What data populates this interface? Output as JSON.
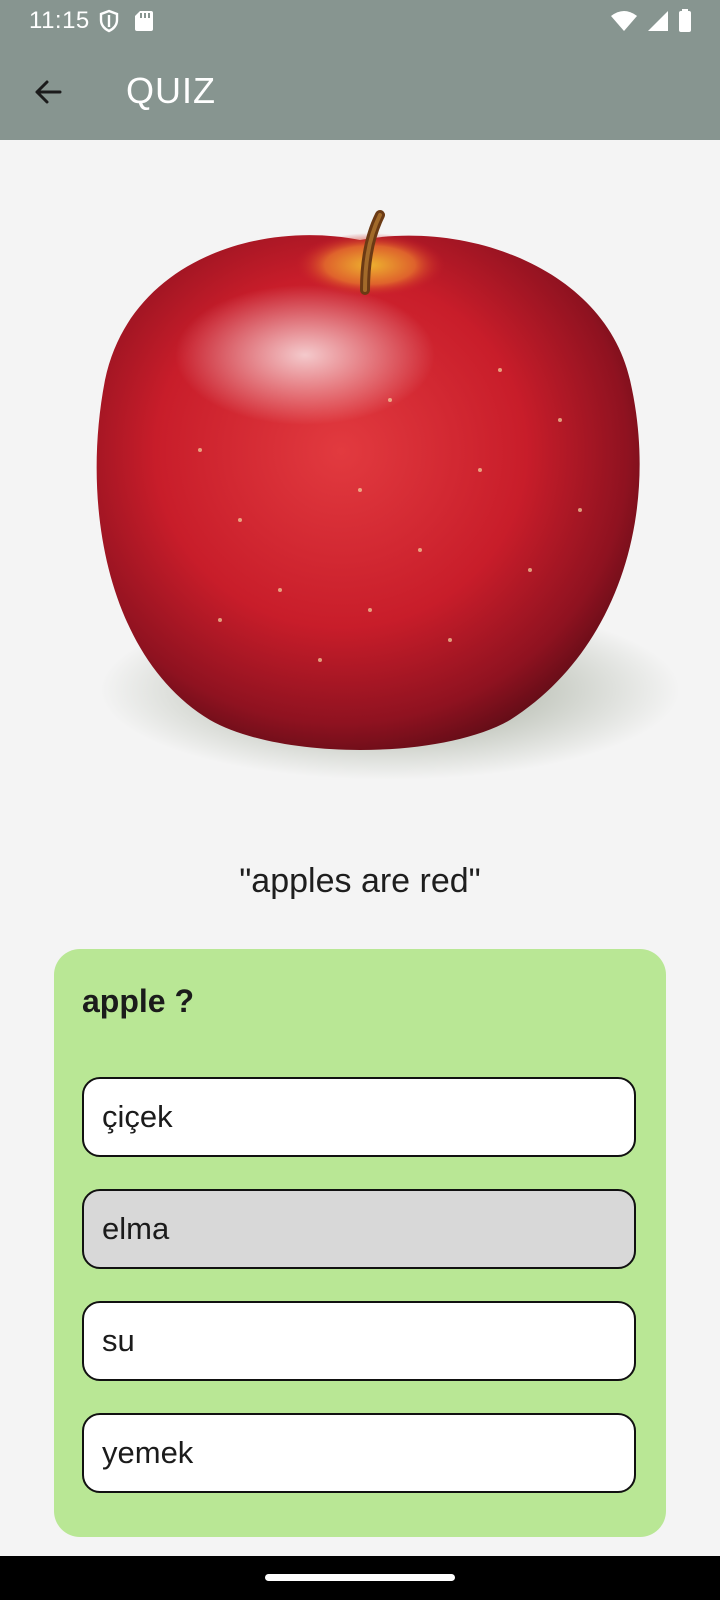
{
  "status_bar": {
    "time": "11:15",
    "icons": [
      "shield-icon",
      "sd-card-icon",
      "wifi-icon",
      "cellular-signal-icon",
      "battery-icon"
    ]
  },
  "app_bar": {
    "back_icon": "arrow-back-icon",
    "title": "QUIZ",
    "background": "#879590"
  },
  "main": {
    "image_subject": "red apple",
    "caption": "\"apples are red\""
  },
  "quiz": {
    "question": "apple ?",
    "card_color": "#b9e795",
    "options": [
      {
        "label": "çiçek",
        "selected": false
      },
      {
        "label": "elma",
        "selected": true
      },
      {
        "label": "su",
        "selected": false
      },
      {
        "label": "yemek",
        "selected": false
      }
    ],
    "selected_color": "#d8d8d8"
  }
}
